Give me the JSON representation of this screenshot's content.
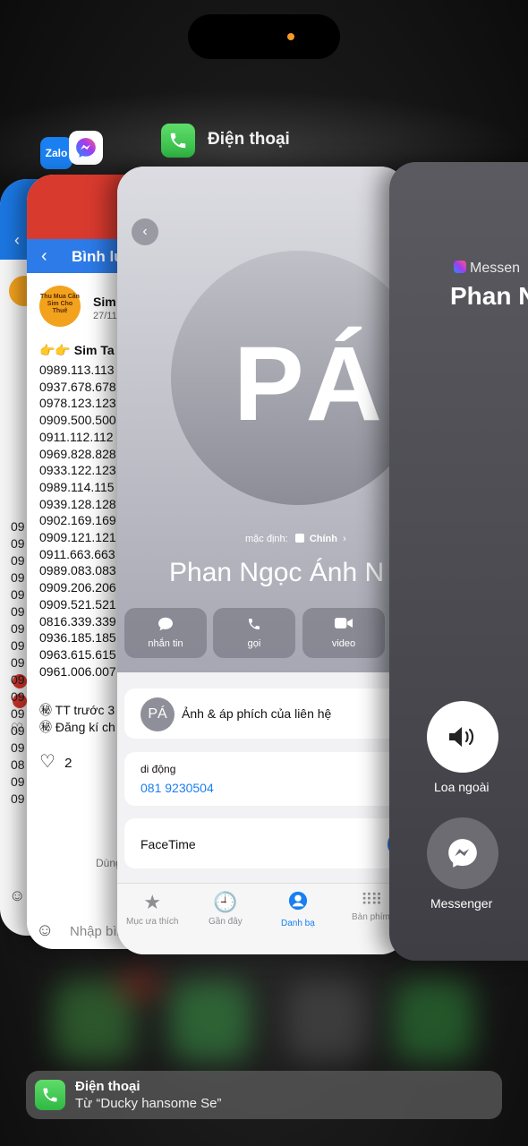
{
  "switcher": {
    "front_app_title": "Điện thoại"
  },
  "zalo_card": {
    "icon_label": "Zalo",
    "lines": [
      "09",
      "09",
      "09",
      "09",
      "09",
      "09",
      "09",
      "09",
      "09",
      "09",
      "09",
      "09",
      "09",
      "09",
      "08",
      "09",
      "09"
    ]
  },
  "comment_card": {
    "header_title": "Bình lu",
    "avatar_text": "Thu Mua Cần Sim Cho Thuê",
    "author": "Sim",
    "date": "27/11",
    "intro": "👉👉 Sim Ta",
    "numbers": [
      "0989.113.113",
      "0937.678.678",
      "0978.123.123",
      "0909.500.500",
      "0911.112.112 =",
      "0969.828.828",
      "0933.122.123",
      "0989.114.115",
      "0939.128.128",
      "0902.169.169",
      "0909.121.121",
      "0911.663.663",
      "0989.083.083",
      "0909.206.206",
      "0909.521.521",
      "0816.339.339",
      "0936.185.185",
      "0963.615.615",
      "0961.006.007"
    ],
    "note1": "㊙ TT trước 3",
    "note2": "㊙ Đăng kí ch",
    "like_count": "2",
    "footer": "Dùng",
    "input_placeholder": "Nhập bìn"
  },
  "phone_card": {
    "initials": "PÁ",
    "default_label": "mặc định:",
    "default_value": "Chính",
    "contact_name": "Phan Ngọc  Ánh N",
    "actions": [
      {
        "label": "nhắn tin",
        "icon": "message-icon"
      },
      {
        "label": "gọi",
        "icon": "phone-icon"
      },
      {
        "label": "video",
        "icon": "video-icon"
      }
    ],
    "poster_initials": "PÁ",
    "poster_label": "Ảnh & áp phích của liên hệ",
    "mobile_label": "di động",
    "mobile_number": "081 9230504",
    "facetime_label": "FaceTime",
    "tabs": [
      {
        "label": "Mục ưa thích",
        "icon": "star-icon"
      },
      {
        "label": "Gần đây",
        "icon": "clock-icon"
      },
      {
        "label": "Danh bạ",
        "icon": "contacts-icon"
      },
      {
        "label": "Bàn phím",
        "icon": "keypad-icon"
      }
    ],
    "active_tab": "Danh bạ"
  },
  "call_card": {
    "app_label": "Messen",
    "caller_name": "Phan N",
    "speaker_label": "Loa ngoài",
    "messenger_label": "Messenger"
  },
  "banner": {
    "title": "Điện thoại",
    "subtitle": "Từ “Ducky hansome Se”"
  },
  "colors": {
    "phone_green": "#34c759",
    "ios_blue": "#1a7ff0",
    "fb_red": "#d93a2e",
    "fb_blue": "#2c7be8"
  }
}
